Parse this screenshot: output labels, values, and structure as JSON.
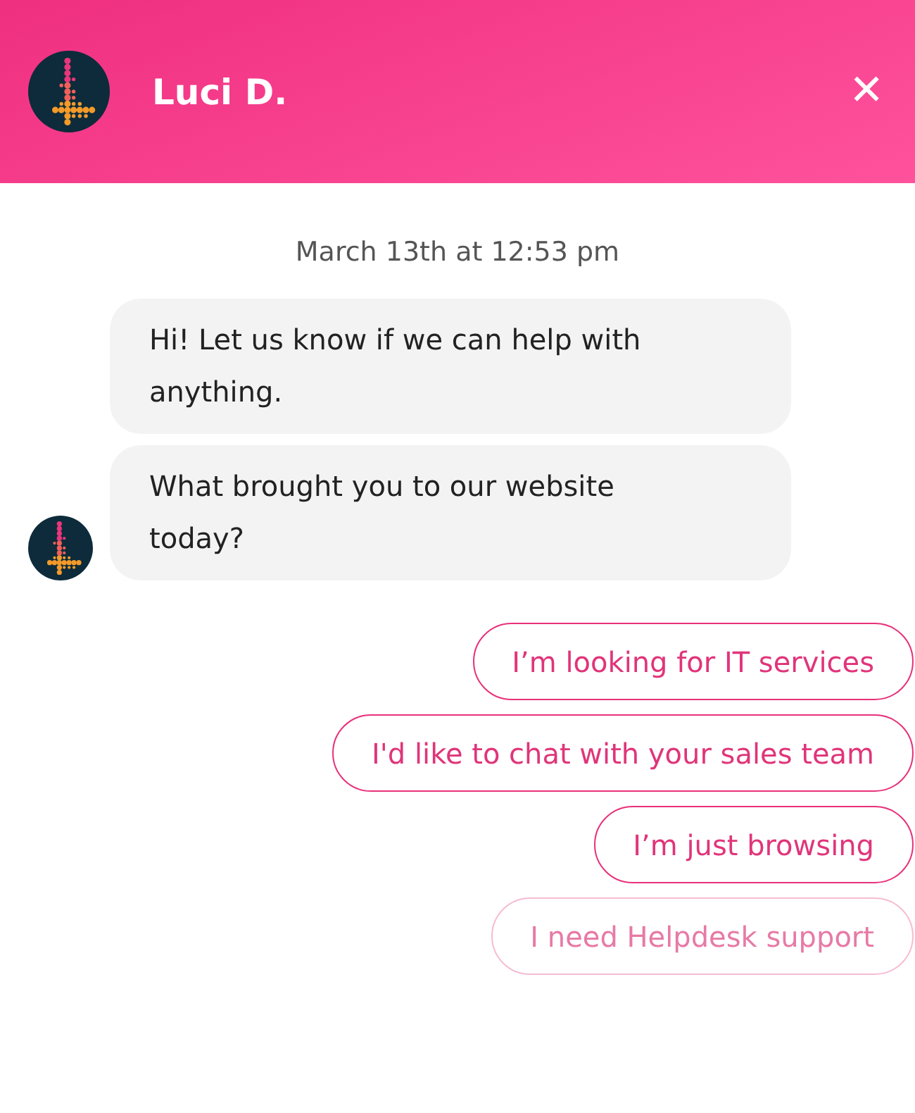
{
  "header": {
    "agent_name": "Luci D.",
    "close": "✕"
  },
  "timestamp": "March 13th at 12:53 pm",
  "messages": [
    {
      "text": "Hi! Let us know if we can help with anything."
    },
    {
      "text": "What brought you to our website today?"
    }
  ],
  "quick_replies": [
    {
      "label": "I’m looking for IT services",
      "disabled": false
    },
    {
      "label": "I'd like to chat with your sales team",
      "disabled": false
    },
    {
      "label": "I’m just browsing",
      "disabled": false
    },
    {
      "label": "I need Helpdesk support",
      "disabled": true
    }
  ]
}
